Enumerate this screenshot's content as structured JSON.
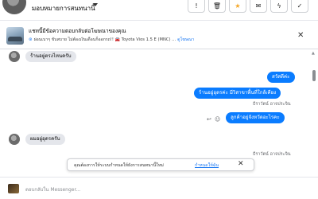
{
  "header": {
    "contact_name": "มอบหมายการสนทนานี้",
    "buttons": [
      {
        "icon": "alert-icon",
        "glyph": "!"
      },
      {
        "icon": "trash-icon",
        "glyph": "🗑"
      },
      {
        "icon": "star-icon",
        "glyph": "★"
      },
      {
        "icon": "mail-icon",
        "glyph": "✉"
      },
      {
        "icon": "tag-icon",
        "glyph": "ϟ"
      },
      {
        "icon": "check-icon",
        "glyph": "✓"
      }
    ],
    "accent_star": "#f5a623"
  },
  "banner": {
    "title": "แชทนี้มีข้อความตอบกลับต่อโฆษณาของคุณ",
    "ad_text": "ผ่อนเบาๆ ขับสบาย ไม่ต้องเงินเดือนก็ออกรถ!! 🚘 Toyota Vios 1.5 E (MNC) ...",
    "link": "ดูโฆษณา",
    "close_glyph": "✕"
  },
  "messages": {
    "m1": "ร้านอยู่ตรงไหนครับ",
    "m2": "สวัสดีค่ะ",
    "m3": "ร้านอยู่อุดรค่ะ มีวิสาขาพื้นที่ใกล้เคียง",
    "m4_sender": "ธีราวัตน์ อาจประจิน",
    "m5": "ลูกค้าอยู่จังหวัดอะไรคะ",
    "m6": "ผมอยู่อุดรครับ",
    "m7_sender": "ธีราวัตน์ อาจประจิน"
  },
  "toast": {
    "text": "คุณต้องการให้ระบบกำหนดให้ยังการสนทนานี้ใหม่",
    "link": "กำหนดให้ฉัน",
    "close_glyph": "✕"
  },
  "composer": {
    "placeholder": "ตอบกลับใน Messenger..."
  },
  "colors": {
    "outgoing_bubble": "#0a7cff",
    "incoming_bubble": "#e4e6eb",
    "link": "#1877f2"
  }
}
